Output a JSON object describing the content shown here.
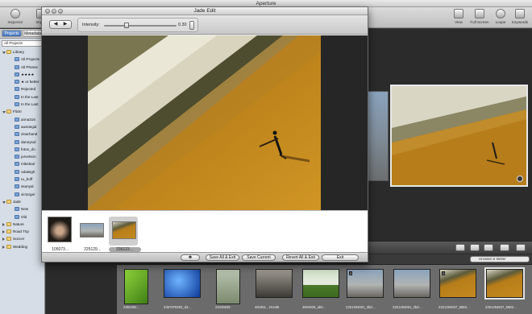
{
  "app": {
    "title": "Aperture"
  },
  "toolbar": {
    "left": [
      {
        "label": "Inspector"
      },
      {
        "label": "Import"
      }
    ],
    "right": [
      {
        "label": "View"
      },
      {
        "label": "Full Screen"
      },
      {
        "label": "Loupe"
      },
      {
        "label": "Keywords"
      }
    ]
  },
  "inspector": {
    "tabs": [
      "Projects",
      "Metadata"
    ],
    "filter_label": "All Projects",
    "tree": [
      {
        "label": "Library",
        "level": 0,
        "disclosure": "open",
        "icon": "library-icon"
      },
      {
        "label": "All Projects",
        "level": 1,
        "icon": "projects-icon"
      },
      {
        "label": "All Photos",
        "level": 1,
        "icon": "photos-icon"
      },
      {
        "label": "★★★★",
        "level": 1,
        "icon": "album-icon"
      },
      {
        "label": "★ or better",
        "level": 1,
        "icon": "album-icon"
      },
      {
        "label": "Rejected",
        "level": 1,
        "icon": "album-icon"
      },
      {
        "label": "In the Last",
        "level": 1,
        "icon": "album-icon"
      },
      {
        "label": "In the Last",
        "level": 1,
        "icon": "album-icon"
      },
      {
        "label": "Flickr",
        "level": 0,
        "disclosure": "open",
        "icon": "folder-icon"
      },
      {
        "label": "anna316",
        "level": 1,
        "icon": "album-icon"
      },
      {
        "label": "aussiegal",
        "level": 1,
        "icon": "album-icon"
      },
      {
        "label": "clearhand",
        "level": 1,
        "icon": "album-icon"
      },
      {
        "label": "dannysul",
        "level": 1,
        "icon": "album-icon"
      },
      {
        "label": "fotos_do",
        "level": 1,
        "icon": "album-icon"
      },
      {
        "label": "jurvetson",
        "level": 1,
        "icon": "album-icon"
      },
      {
        "label": "mikebair",
        "level": 1,
        "icon": "album-icon"
      },
      {
        "label": "odaleigh",
        "level": 1,
        "icon": "album-icon"
      },
      {
        "label": "ru_boff",
        "level": 1,
        "icon": "album-icon"
      },
      {
        "label": "ssanyal",
        "level": 1,
        "icon": "album-icon"
      },
      {
        "label": "victorger",
        "level": 1,
        "icon": "album-icon"
      },
      {
        "label": "Jade",
        "level": 0,
        "disclosure": "open",
        "icon": "folder-icon"
      },
      {
        "label": "New",
        "level": 1,
        "icon": "album-icon"
      },
      {
        "label": "Old",
        "level": 1,
        "icon": "album-icon"
      },
      {
        "label": "Nature",
        "level": 0,
        "disclosure": "closed",
        "icon": "folder-icon"
      },
      {
        "label": "Road Trip",
        "level": 0,
        "disclosure": "closed",
        "icon": "folder-icon"
      },
      {
        "label": "Soccer",
        "level": 0,
        "disclosure": "closed",
        "icon": "folder-icon"
      },
      {
        "label": "Wedding",
        "level": 0,
        "disclosure": "closed",
        "icon": "folder-icon"
      }
    ]
  },
  "filter_bar": {
    "rating_filter": "Unrated or Better"
  },
  "browser": {
    "captions": [
      "2362484…",
      "2357978393_d3…",
      "23445945",
      "481851…Rce89",
      "3604929_ab0…",
      "2251294081_2bd…",
      "2251294081_2bd…",
      "2251294937_5983…",
      "2251294937_5983…"
    ],
    "badges": [
      "2",
      "2"
    ]
  },
  "edit": {
    "title": "Jade Edit",
    "intensity_label": "Intensity:",
    "intensity_value": "0.30",
    "intensity": 0.3,
    "nav_prev": "◀",
    "nav_next": "▶",
    "strip": [
      {
        "caption": "105073…"
      },
      {
        "caption": "225129…"
      },
      {
        "caption": "236123…"
      }
    ],
    "buttons": {
      "gear": "✽",
      "save_all_exit": "Save All & Exit",
      "save_current": "Save Current",
      "revert_all_exit": "Revert All & Exit",
      "exit": "Exit"
    }
  },
  "colors": {
    "sand": "#c48a1e",
    "selection": "#3f6fb7"
  }
}
